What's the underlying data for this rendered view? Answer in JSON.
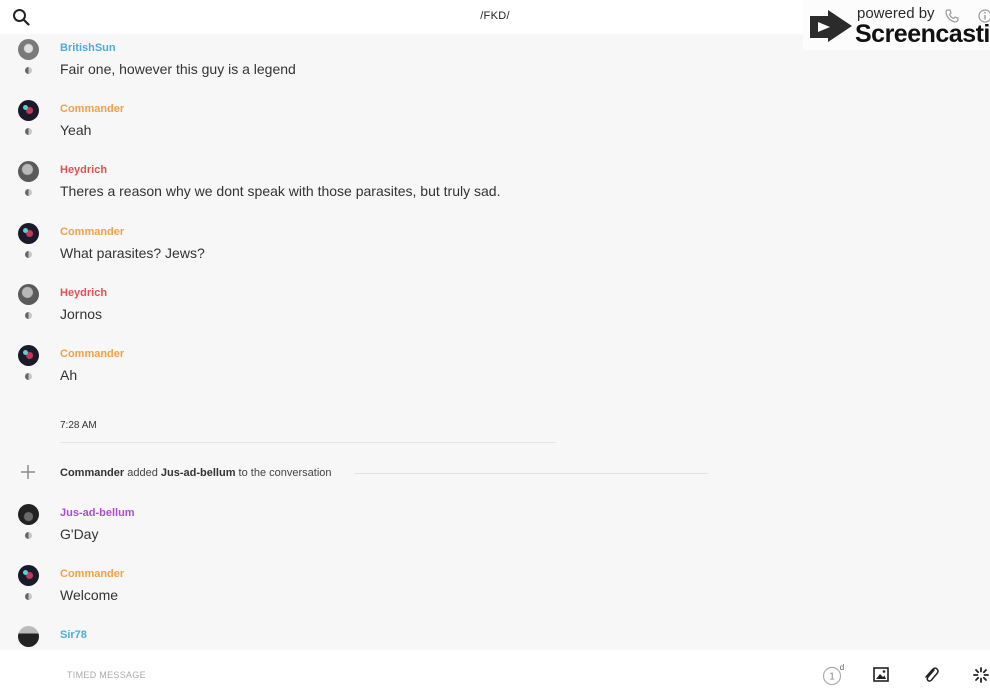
{
  "header": {
    "title": "/FKD/",
    "watermark": {
      "line1": "powered by",
      "line2": "Screencastify"
    }
  },
  "messages": [
    {
      "author": "BritishSun",
      "text": "Fair one, however this guy is a legend",
      "color": "#4aaedb"
    },
    {
      "author": "Commander",
      "text": "Yeah",
      "color": "#f0a147"
    },
    {
      "author": "Heydrich",
      "text": "Theres a reason why we dont speak with those parasites, but truly sad.",
      "color": "#e05252"
    },
    {
      "author": "Commander",
      "text": "What parasites? Jews?",
      "color": "#f0a147"
    },
    {
      "author": "Heydrich",
      "text": "Jornos",
      "color": "#e05252"
    },
    {
      "author": "Commander",
      "text": "Ah",
      "color": "#f0a147"
    },
    {
      "author": "Jus-ad-bellum",
      "text": "G'Day",
      "color": "#b14ad1"
    },
    {
      "author": "Commander",
      "text": "Welcome",
      "color": "#f0a147"
    },
    {
      "author": "Sir78",
      "text": "",
      "color": "#4aaedb"
    }
  ],
  "timestamp": "7:28 AM",
  "system_event": {
    "actor": "Commander",
    "verb": "added",
    "subject": "Jus-ad-bellum",
    "suffix": "to the conversation"
  },
  "composer": {
    "placeholder": "TIMED MESSAGE",
    "timer_count": "1",
    "timer_unit": "d"
  },
  "icons": {
    "search": "search-icon",
    "plus": "plus-icon",
    "timer": "timer-icon",
    "image": "image-icon",
    "attach": "paperclip-icon",
    "sparkle": "sparkle-icon",
    "phone": "phone-icon",
    "info": "info-icon"
  }
}
